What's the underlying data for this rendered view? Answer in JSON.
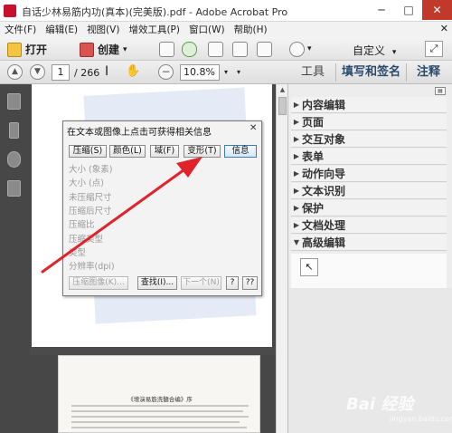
{
  "window": {
    "title": "自话少林易筋内功(真本)(完美版).pdf - Adobe Acrobat Pro",
    "minimize": "─",
    "maximize": "□",
    "close": "✕"
  },
  "menu": {
    "items": [
      "文件(F)",
      "编辑(E)",
      "视图(V)",
      "增效工具(P)",
      "窗口(W)",
      "帮助(H)"
    ],
    "close_doc": "✕"
  },
  "toolbar": {
    "open_label": "打开",
    "create_label": "创建",
    "create_arrow": "▾",
    "settings_arrow": "▾",
    "customize_label": "自定义",
    "customize_arrow": "▾",
    "expand": "⤢"
  },
  "navbar": {
    "page_current": "1",
    "page_total": "/ 266",
    "zoom_out": "−",
    "zoom_value": "10.8%",
    "zoom_arrow": "▾",
    "more_arrow": "▾",
    "up": "▲",
    "down": "▼"
  },
  "right_tabs": {
    "tools": "工具",
    "fill_sign": "填写和签名",
    "comment": "注释"
  },
  "panel": {
    "options": "▤",
    "sections": [
      {
        "label": "内容编辑",
        "state": "collapsed"
      },
      {
        "label": "页面",
        "state": "collapsed"
      },
      {
        "label": "交互对象",
        "state": "collapsed"
      },
      {
        "label": "表单",
        "state": "collapsed"
      },
      {
        "label": "动作向导",
        "state": "collapsed"
      },
      {
        "label": "文本识别",
        "state": "collapsed"
      },
      {
        "label": "保护",
        "state": "collapsed"
      },
      {
        "label": "文档处理",
        "state": "collapsed"
      },
      {
        "label": "高级编辑",
        "state": "expanded"
      }
    ],
    "tri_collapsed": "▶",
    "tri_expanded": "▼",
    "adv_tool_icon": "↖"
  },
  "dialog": {
    "title": "在文本或图像上点击可获得相关信息",
    "close": "✕",
    "tabs": [
      "压缩(S)",
      "颜色(L)",
      "域(F)",
      "变形(T)",
      "信息"
    ],
    "fields": [
      "大小 (象素)",
      "大小 (点)",
      "未压缩尺寸",
      "压缩后尺寸",
      "压缩比",
      "压缩类型",
      "类型",
      "分辨率(dpi)"
    ],
    "btn_compress_image": "压缩图像(K)...",
    "btn_find": "查找(I)...",
    "btn_next": "下一个(N)",
    "btn_help": "?",
    "btn_help2": "??"
  },
  "page2": {
    "heading": "《增演易筋洗髓合编》序"
  },
  "watermark": {
    "text": "Bai 经验",
    "sub": "jingyan.baidu.com"
  },
  "colors": {
    "arrow": "#e0242c",
    "panel_heading": "#2a4a6b",
    "close_button": "#c0392b"
  }
}
